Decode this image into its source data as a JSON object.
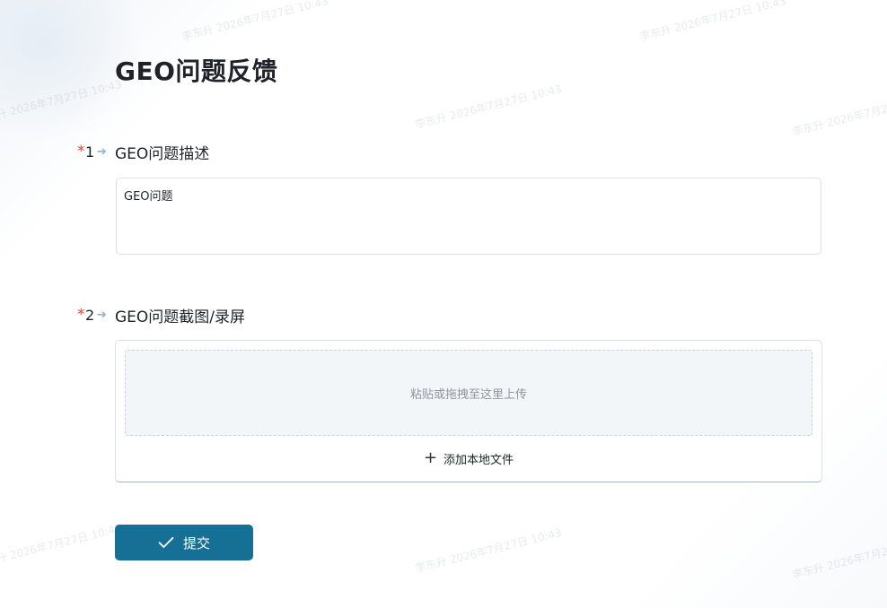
{
  "form": {
    "title": "GEO问题反馈"
  },
  "questions": [
    {
      "required_mark": "*",
      "number": "1",
      "arrow": "➔",
      "label": "GEO问题描述",
      "value": "GEO问题"
    },
    {
      "required_mark": "*",
      "number": "2",
      "arrow": "➔",
      "label": "GEO问题截图/录屏",
      "drop_hint": "粘贴或拖拽至这里上传",
      "add_file_icon": "plus-icon",
      "add_file_label": "添加本地文件"
    }
  ],
  "submit": {
    "icon": "check-icon",
    "label": "提交"
  },
  "watermark": {
    "text": "李东升 2026年7月27日 10:43"
  },
  "colors": {
    "primary": "#166f94",
    "required": "#e0443a",
    "border": "#dee0e3",
    "drop_bg": "#f3f6f8"
  }
}
